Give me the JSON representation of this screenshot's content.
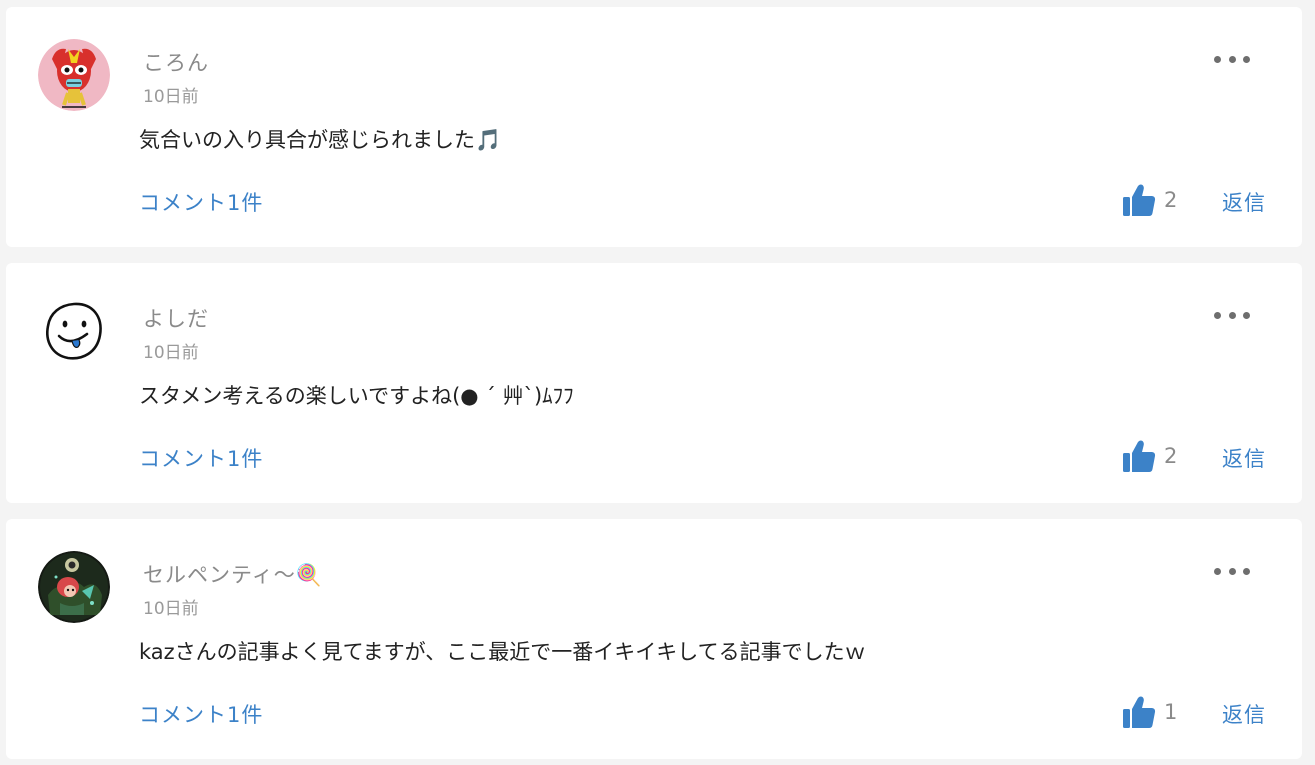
{
  "comments": [
    {
      "username": "ころん",
      "timestamp": "10日前",
      "text": "気合いの入り具合が感じられました🎵",
      "replies_label": "コメント1件",
      "likes": "2",
      "reply_label": "返信",
      "avatar": "masked-wrestler-dog-avatar"
    },
    {
      "username": "よしだ",
      "timestamp": "10日前",
      "text": "スタメン考えるの楽しいですよね(● ´ 艸`)ﾑﾌﾌ",
      "replies_label": "コメント1件",
      "likes": "2",
      "reply_label": "返信",
      "avatar": "smiley-face-avatar"
    },
    {
      "username": "セルペンティ〜🍭",
      "timestamp": "10日前",
      "text": "kazさんの記事よく見てますが、ここ最近で一番イキイキしてる記事でしたｗ",
      "replies_label": "コメント1件",
      "likes": "1",
      "reply_label": "返信",
      "avatar": "anime-character-avatar"
    }
  ],
  "icons": {
    "like": "thumbs-up-icon",
    "more": "more-options-icon"
  },
  "colors": {
    "link": "#3c82c8",
    "like_icon": "#3c82c8",
    "meta_text": "#8a8a8a",
    "body_text": "#222222",
    "card_bg": "#ffffff",
    "page_bg": "#f4f4f4"
  }
}
